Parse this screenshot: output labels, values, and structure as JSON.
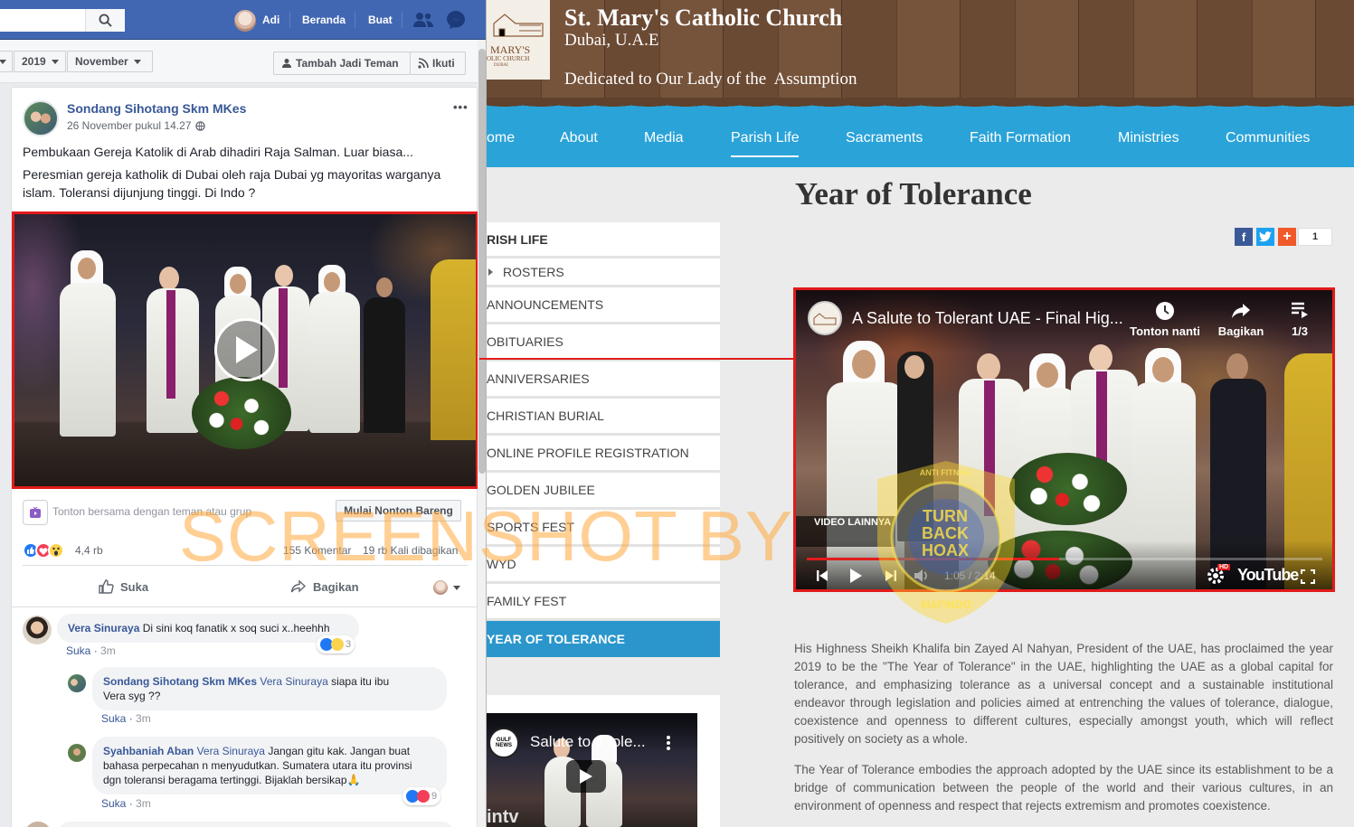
{
  "facebook": {
    "top_nav": {
      "user_name": "Adi",
      "home": "Beranda",
      "create": "Buat"
    },
    "filter": {
      "year": "2019",
      "month": "November",
      "add_friend": "Tambah Jadi Teman",
      "follow": "Ikuti"
    },
    "post": {
      "author": "Sondang Sihotang Skm MKes",
      "timestamp": "26 November pukul 14.27",
      "more": "•••",
      "text1": "Pembukaan Gereja Katolik di Arab dihadiri Raja Salman. Luar biasa...",
      "text2": "Peresmian gereja katholik di Dubai oleh raja Dubai yg mayoritas warganya islam. Toleransi dijunjung tinggi. Di Indo ?",
      "watch_together": "Tonton bersama dengan teman atau grup",
      "watch_party_button": "Mulai Nonton Bareng",
      "reactions_count": "4,4 rb",
      "comments_count": "155 Komentar",
      "shares_count": "19 rb Kali dibagikan",
      "like_action": "Suka",
      "share_action": "Bagikan"
    },
    "comments": [
      {
        "author": "Vera Sinuraya",
        "text": "Di sini koq fanatik x soq suci x..heehhh",
        "like": "Suka",
        "time": "3m",
        "reactions": "3"
      },
      {
        "author": "Sondang Sihotang Skm MKes",
        "mention": "Vera Sinuraya",
        "text_a": "siapa itu ibu",
        "text_b": "Vera syg ??",
        "like": "Suka",
        "time": "3m"
      },
      {
        "author": "Syahbaniah Aban",
        "mention": "Vera Sinuraya",
        "text_a": "Jangan gitu kak. Jangan buat",
        "text_b": "bahasa perpecahan n menyudutkan. Sumatera utara itu provinsi",
        "text_c": "dgn toleransi beragama tertinggi. Bijaklah bersikap🙏",
        "like": "Suka",
        "time": "3m",
        "reactions": "9"
      }
    ]
  },
  "site": {
    "title": "St. Mary's Catholic Church",
    "location": "Dubai, U.A.E",
    "dedication": "Dedicated to Our Lady of the  Assumption",
    "logo_text": "MARY'S",
    "logo_sub": "OLIC CHURCH",
    "logo_city": "DUBAI",
    "nav": [
      "ome",
      "About",
      "Media",
      "Parish Life",
      "Sacraments",
      "Faith Formation",
      "Ministries",
      "Communities"
    ],
    "sidemenu": {
      "heading": "RISH LIFE",
      "items": [
        "ROSTERS",
        "ANNOUNCEMENTS",
        "OBITUARIES",
        "ANNIVERSARIES",
        "CHRISTIAN BURIAL",
        "ONLINE PROFILE REGISTRATION",
        "GOLDEN JUBILEE",
        "SPORTS FEST",
        "WYD",
        "FAMILY FEST",
        "YEAR OF TOLERANCE"
      ]
    },
    "article": {
      "title": "Year of Tolerance",
      "share_count": "1",
      "para1": "His Highness Sheikh Khalifa bin Zayed Al Nahyan, President of the UAE, has proclaimed the year 2019 to be the \"The Year of Tolerance\" in the UAE, highlighting the UAE as a global capital for tolerance, and emphasizing tolerance as a universal concept and a sustainable institutional endeavor through legislation and policies aimed at entrenching the values of tolerance, dialogue, coexistence and openness to different cultures, especially amongst youth, which will reflect positively on society as a whole.",
      "para2": "The Year of Tolerance embodies the approach adopted by the UAE since its establishment to be a bridge of communication between the people of the world and their various cultures, in an environment of openness and respect that rejects extremism and promotes coexistence."
    },
    "video": {
      "title": "A Salute to Tolerant UAE - Final Hig...",
      "watch_later": "Tonton nanti",
      "share": "Bagikan",
      "playlist": "1/3",
      "more_videos": "VIDEO LAINNYA",
      "time": "1:05 / 2:14",
      "brand": "YouTube",
      "progress": 0.49,
      "hd": "HD"
    },
    "side_video": {
      "title": "Salute to a tole...",
      "channel": "GULF NEWS",
      "watermark": "intv"
    }
  },
  "overlay": {
    "watermark": "SCREENSHOT BY",
    "seal_text_top": "ANTI FITNAH",
    "seal_lines": [
      "TURN",
      "BACK",
      "HOAX"
    ],
    "seal_bottom": "MAFINDO"
  },
  "colors": {
    "fb_blue": "#4267b2",
    "fb_link": "#385898",
    "site_blue": "#2aa3d8",
    "highlight_red": "#e11b1b"
  }
}
